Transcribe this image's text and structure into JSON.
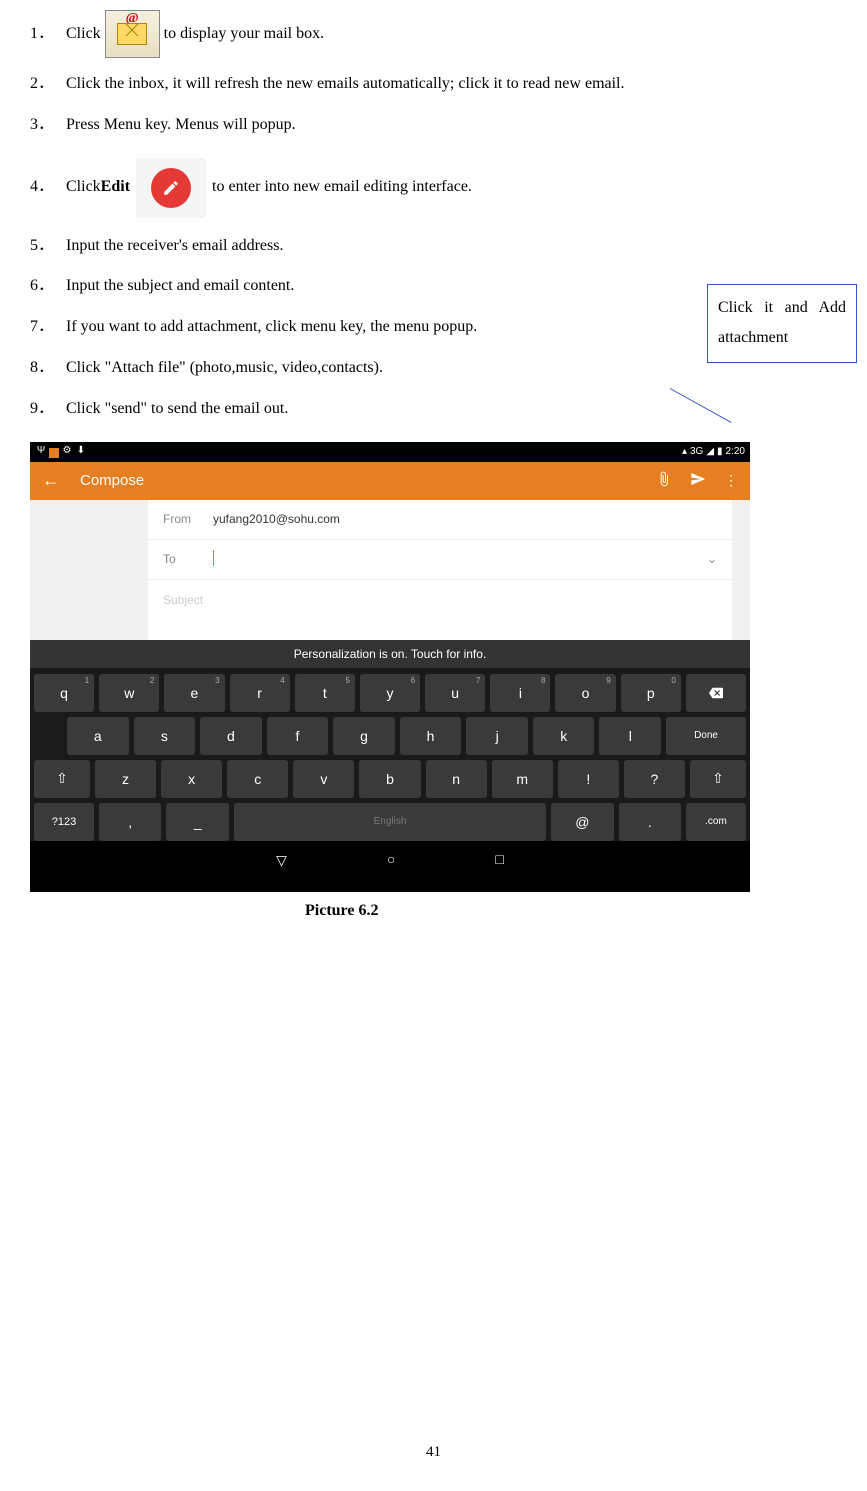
{
  "steps": {
    "s1_num": "1．",
    "s1_a": "Click",
    "s1_b": " to display your mail box.",
    "s2_num": "2．",
    "s2": "Click the inbox, it will refresh the new emails automatically; click it to read new email.",
    "s3_num": "3．",
    "s3": "Press Menu key. Menus will popup.",
    "s4_num": "4．",
    "s4_a": "Click ",
    "s4_bold": "Edit",
    "s4_b": "  to enter into new email editing interface.",
    "s5_num": "5．",
    "s5": "Input the receiver's email address.",
    "s6_num": "6．",
    "s6": "Input the subject and email content.",
    "s7_num": "7．",
    "s7": "If you want to add attachment, click menu key, the menu popup.",
    "s8_num": "8．",
    "s8": "Click \"Attach file\" (photo,music, video,contacts).",
    "s9_num": "9．",
    "s9": "Click \"send\" to send the email out."
  },
  "callout": {
    "c1": "Click it and Add attachment"
  },
  "screenshot": {
    "statusbar_time": "2:20",
    "statusbar_3g": "3G",
    "compose_title": "Compose",
    "from_label": "From",
    "from_value": "yufang2010@sohu.com",
    "to_label": "To",
    "subject_label": "Subject",
    "personalization": "Personalization is on. Touch for info.",
    "keys": {
      "row1": [
        "q",
        "w",
        "e",
        "r",
        "t",
        "y",
        "u",
        "i",
        "o",
        "p"
      ],
      "row1_sup": [
        "1",
        "2",
        "3",
        "4",
        "5",
        "6",
        "7",
        "8",
        "9",
        "0"
      ],
      "row2": [
        "a",
        "s",
        "d",
        "f",
        "g",
        "h",
        "j",
        "k",
        "l"
      ],
      "row3": [
        "z",
        "x",
        "c",
        "v",
        "b",
        "n",
        "m",
        "!",
        "?"
      ],
      "done": "Done",
      "n123": "?123",
      "comma": ",",
      "underscore": "_",
      "space": "English",
      "at": "@",
      "dot": ".",
      "com": ".com"
    }
  },
  "caption": "Picture 6.2",
  "page_number": "41"
}
